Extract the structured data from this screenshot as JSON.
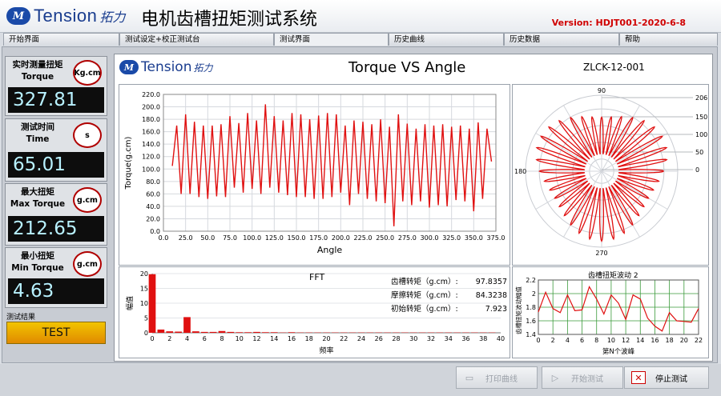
{
  "brand": {
    "logo_text": "Tension",
    "logo_sub": "拓力"
  },
  "app": {
    "title": "电机齿槽扭矩测试系统",
    "version": "Version: HDJT001-2020-6-8"
  },
  "tabs": [
    {
      "label": "开始界面"
    },
    {
      "label": "测试设定+校正测试台"
    },
    {
      "label": "测试界面"
    },
    {
      "label": "历史曲线"
    },
    {
      "label": "历史数据"
    },
    {
      "label": "帮助"
    }
  ],
  "readings": [
    {
      "label_cn": "实时测量扭矩",
      "label_en": "Torque",
      "unit": "Kg.cm",
      "value": "327.81"
    },
    {
      "label_cn": "测试时间",
      "label_en": "Time",
      "unit": "s",
      "value": "65.01"
    },
    {
      "label_cn": "最大扭矩",
      "label_en": "Max Torque",
      "unit": "g.cm",
      "value": "212.65"
    },
    {
      "label_cn": "最小扭矩",
      "label_en": "Min Torque",
      "unit": "g.cm",
      "value": "4.63"
    }
  ],
  "result": {
    "label": "测试结果",
    "button": "TEST"
  },
  "main": {
    "title": "Torque VS Angle",
    "model": "ZLCK-12-001"
  },
  "fft": {
    "title": "FFT",
    "stats": [
      {
        "label": "齿槽转矩（g.cm）:",
        "value": "97.8357"
      },
      {
        "label": "摩擦转矩（g.cm）:",
        "value": "84.3238"
      },
      {
        "label": "初始转矩（g.cm）:",
        "value": "7.923"
      }
    ]
  },
  "wave": {
    "title": "齿槽扭矩波动 2"
  },
  "footer": {
    "print_label": "打印曲线",
    "start_label": "开始测试",
    "stop_label": "停止测试"
  },
  "colors": {
    "trace": "#e01010",
    "readout_text": "#b8f1ff",
    "test_button": "#f0b000",
    "version": "#d00000",
    "unit_ring": "#b00000"
  },
  "icons": [
    "print-icon",
    "play-icon",
    "stop-icon"
  ],
  "chart_data": [
    {
      "type": "line",
      "title": "Torque VS Angle",
      "xlabel": "Angle",
      "ylabel": "Torque(g.cm)",
      "xlim": [
        0,
        375
      ],
      "ylim": [
        0,
        220
      ],
      "xticks": [
        "0.0",
        "25.0",
        "50.0",
        "75.0",
        "100.0",
        "125.0",
        "150.0",
        "175.0",
        "200.0",
        "225.0",
        "250.0",
        "275.0",
        "300.0",
        "325.0",
        "350.0",
        "375.0"
      ],
      "yticks": [
        "0.0",
        "20.0",
        "40.0",
        "60.0",
        "80.0",
        "100.0",
        "120.0",
        "140.0",
        "160.0",
        "180.0",
        "200.0",
        "220.0"
      ],
      "series": [
        {
          "x": [
            10,
            15,
            20,
            25,
            30,
            35,
            40,
            45,
            50,
            55,
            60,
            65,
            70,
            75,
            80,
            85,
            90,
            95,
            100,
            105,
            110,
            115,
            120,
            125,
            130,
            135,
            140,
            145,
            150,
            155,
            160,
            165,
            170,
            175,
            180,
            185,
            190,
            195,
            200,
            205,
            210,
            215,
            220,
            225,
            230,
            235,
            240,
            245,
            250,
            255,
            260,
            265,
            270,
            275,
            280,
            285,
            290,
            295,
            300,
            305,
            310,
            315,
            320,
            325,
            330,
            335,
            340,
            345,
            350,
            355,
            360,
            365,
            370
          ],
          "y": [
            105,
            170,
            60,
            188,
            60,
            176,
            55,
            170,
            52,
            170,
            56,
            172,
            55,
            185,
            70,
            174,
            62,
            190,
            68,
            178,
            60,
            204,
            70,
            185,
            62,
            178,
            58,
            190,
            55,
            188,
            55,
            180,
            52,
            186,
            52,
            190,
            55,
            188,
            62,
            170,
            42,
            178,
            60,
            176,
            52,
            172,
            48,
            180,
            45,
            168,
            8,
            188,
            48,
            173,
            42,
            165,
            48,
            172,
            38,
            170,
            42,
            172,
            40,
            168,
            50,
            170,
            48,
            165,
            32,
            175,
            52,
            165,
            112
          ]
        }
      ]
    },
    {
      "type": "polar",
      "radial_ticks": [
        "206",
        "150",
        "100",
        "50",
        "0"
      ],
      "angle_labels": [
        "90",
        "180",
        "270"
      ],
      "petals": 36,
      "r_min": 50,
      "r_max": 206
    },
    {
      "type": "bar",
      "title": "FFT",
      "xlabel": "频率",
      "ylabel": "幅值",
      "xlim": [
        0,
        40
      ],
      "ylim": [
        0,
        20
      ],
      "xticks": [
        "0",
        "2",
        "4",
        "6",
        "8",
        "10",
        "12",
        "14",
        "16",
        "18",
        "20",
        "22",
        "24",
        "26",
        "28",
        "30",
        "32",
        "34",
        "36",
        "38",
        "40"
      ],
      "yticks": [
        "0",
        "5",
        "10",
        "15",
        "20"
      ],
      "x": [
        0,
        1,
        2,
        3,
        4,
        5,
        6,
        7,
        8,
        9,
        10,
        11,
        12,
        13,
        14,
        15,
        16,
        17,
        18,
        19,
        20,
        21,
        22,
        23,
        24,
        25,
        26,
        27,
        28,
        29,
        30,
        31,
        32,
        33,
        34,
        35,
        36,
        37,
        38,
        39
      ],
      "values": [
        19.8,
        1.1,
        0.5,
        0.4,
        5.3,
        0.5,
        0.3,
        0.3,
        0.6,
        0.3,
        0.2,
        0.2,
        0.3,
        0.2,
        0.2,
        0.1,
        0.2,
        0.1,
        0.1,
        0.1,
        0.1,
        0.1,
        0.1,
        0.1,
        0.1,
        0.1,
        0.1,
        0.1,
        0.1,
        0.1,
        0.1,
        0.1,
        0.1,
        0.1,
        0.1,
        0.1,
        0.1,
        0.1,
        0.1,
        0.1
      ]
    },
    {
      "type": "line",
      "title": "齿槽扭矩波动 2",
      "xlabel": "第N个波峰",
      "ylabel": "齿槽扭矩波动幅值",
      "xlim": [
        0,
        22
      ],
      "ylim": [
        1.4,
        2.2
      ],
      "xticks": [
        "0",
        "2",
        "4",
        "6",
        "8",
        "10",
        "12",
        "14",
        "16",
        "18",
        "20",
        "22"
      ],
      "yticks": [
        "1.4",
        "1.6",
        "1.8",
        "2",
        "2.2"
      ],
      "series": [
        {
          "x": [
            0,
            1,
            2,
            3,
            4,
            5,
            6,
            7,
            8,
            9,
            10,
            11,
            12,
            13,
            14,
            15,
            16,
            17,
            18,
            19,
            20,
            21,
            22
          ],
          "y": [
            1.73,
            2.02,
            1.78,
            1.72,
            1.98,
            1.75,
            1.76,
            2.1,
            1.92,
            1.7,
            1.98,
            1.86,
            1.62,
            1.98,
            1.92,
            1.64,
            1.52,
            1.45,
            1.72,
            1.6,
            1.59,
            1.58,
            1.78
          ]
        }
      ]
    }
  ]
}
